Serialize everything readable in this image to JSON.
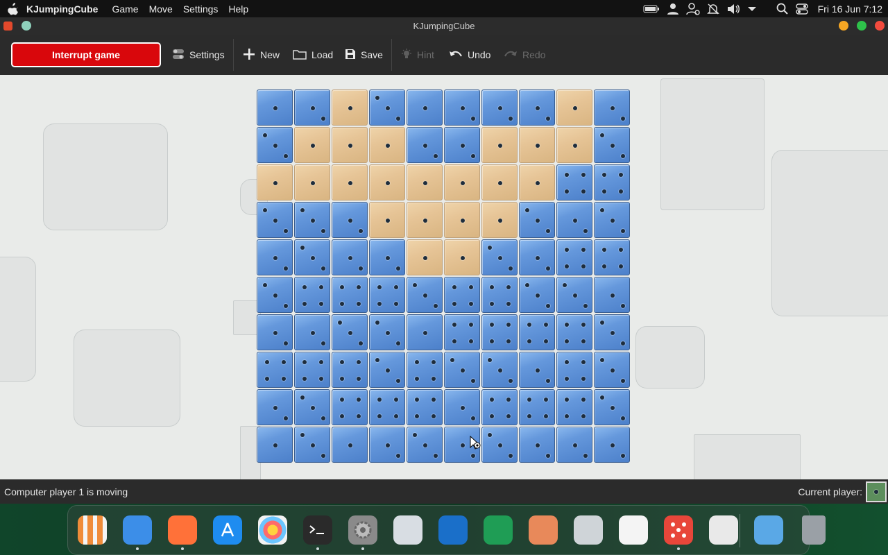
{
  "menubar": {
    "app_name": "KJumpingCube",
    "menus": [
      "Game",
      "Move",
      "Settings",
      "Help"
    ],
    "clock": "Fri 16 Jun 7:12"
  },
  "window": {
    "title": "KJumpingCube"
  },
  "toolbar": {
    "interrupt_label": "Interrupt game",
    "settings_label": "Settings",
    "new_label": "New",
    "load_label": "Load",
    "save_label": "Save",
    "hint_label": "Hint",
    "undo_label": "Undo",
    "redo_label": "Redo"
  },
  "board": {
    "size": 10,
    "colors": {
      "blue": "#5b8fd8",
      "tan": "#e6c496",
      "pip": "#1e2d3d"
    },
    "owners": [
      "BBTBBBBBTB",
      "BTTTBBTTTB",
      "TTTTTTTTBB",
      "BBBTTTTBBB",
      "BBBBTTBBBB",
      "BBBBBBBBBB",
      "BBBBBBBBBB",
      "BBBBBBBBBB",
      "BBBBBBBBBB",
      "BBBBBBBBBB"
    ],
    "pips": [
      [
        1,
        2,
        1,
        3,
        1,
        2,
        2,
        2,
        1,
        2
      ],
      [
        3,
        1,
        1,
        1,
        2,
        2,
        1,
        1,
        1,
        3
      ],
      [
        1,
        1,
        1,
        1,
        1,
        1,
        1,
        1,
        4,
        4
      ],
      [
        3,
        3,
        2,
        1,
        1,
        1,
        1,
        3,
        2,
        3
      ],
      [
        2,
        3,
        2,
        2,
        1,
        1,
        3,
        2,
        4,
        4
      ],
      [
        3,
        4,
        4,
        4,
        3,
        4,
        4,
        3,
        3,
        2
      ],
      [
        2,
        2,
        3,
        3,
        1,
        4,
        4,
        4,
        4,
        3
      ],
      [
        4,
        4,
        4,
        3,
        4,
        3,
        3,
        2,
        4,
        3
      ],
      [
        2,
        3,
        4,
        4,
        4,
        2,
        4,
        4,
        4,
        3
      ],
      [
        1,
        3,
        1,
        2,
        3,
        2,
        3,
        2,
        2,
        2
      ]
    ]
  },
  "statusbar": {
    "message": "Computer player 1 is moving",
    "current_player_label": "Current player:",
    "current_player_color": "#5c8e5c"
  },
  "dock": {
    "apps": [
      {
        "name": "launchpad",
        "color": "#e8e8e8",
        "running": false
      },
      {
        "name": "finder",
        "color": "#3c8ee8",
        "running": true
      },
      {
        "name": "firefox",
        "color": "#ff7139",
        "running": true
      },
      {
        "name": "app-store",
        "color": "#1e8cf0",
        "running": false
      },
      {
        "name": "photos",
        "color": "#f2f2f2",
        "running": false
      },
      {
        "name": "terminal",
        "color": "#2a2a2a",
        "running": true
      },
      {
        "name": "system-settings",
        "color": "#8a8a8a",
        "running": true
      },
      {
        "name": "screenshot",
        "color": "#d8dde3",
        "running": false
      },
      {
        "name": "writer",
        "color": "#1a6fc9",
        "running": false
      },
      {
        "name": "spreadsheet",
        "color": "#1f9d55",
        "running": false
      },
      {
        "name": "paint",
        "color": "#e8895a",
        "running": false
      },
      {
        "name": "media-player",
        "color": "#cfd4d8",
        "running": false
      },
      {
        "name": "text-editor",
        "color": "#f4f4f4",
        "running": false
      },
      {
        "name": "kjumpingcube",
        "color": "#e8463a",
        "running": true
      },
      {
        "name": "calculator",
        "color": "#e9e9e9",
        "running": false
      },
      {
        "name": "downloads",
        "color": "#5aa8e6",
        "running": false
      },
      {
        "name": "trash",
        "color": "#9aa0a6",
        "running": false
      }
    ]
  }
}
